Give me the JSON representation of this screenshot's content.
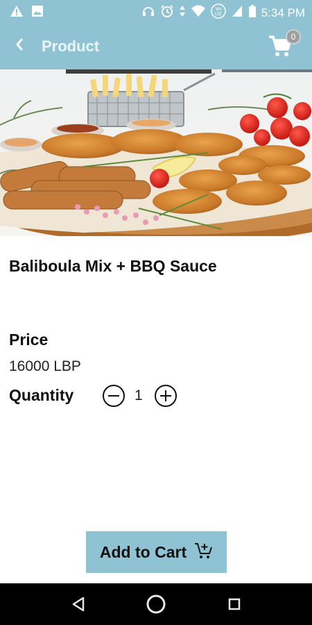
{
  "status_bar": {
    "time": "5:34 PM",
    "icons": [
      "warning-icon",
      "image-icon",
      "headset-icon",
      "alarm-icon",
      "data-arrows-icon",
      "wifi-icon",
      "volte-icon",
      "signal-icon",
      "battery-icon"
    ]
  },
  "app_bar": {
    "title": "Product",
    "back_icon": "back-arrow-icon",
    "cart_icon": "cart-icon",
    "cart_count": "0"
  },
  "product": {
    "image": "product-photo",
    "name": "Baliboula Mix + BBQ Sauce",
    "price_label": "Price",
    "price_value": "16000 LBP",
    "quantity_label": "Quantity",
    "quantity_value": "1"
  },
  "actions": {
    "add_to_cart_label": "Add to Cart",
    "add_to_cart_icon": "add-cart-icon"
  },
  "nav_bar": {
    "buttons": [
      "back-triangle-icon",
      "home-circle-icon",
      "recents-square-icon"
    ]
  },
  "colors": {
    "accent": "#8fc3d3",
    "nav_bar": "#000000",
    "text": "#111111"
  }
}
